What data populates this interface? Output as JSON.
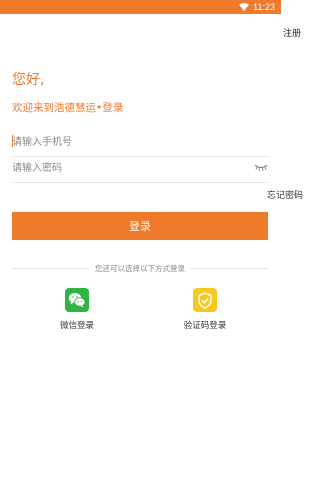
{
  "status_bar": {
    "time": "11:23"
  },
  "header": {
    "register_label": "注册"
  },
  "main": {
    "greeting": "您好,",
    "welcome": "欢迎来到浩德慧运•登录"
  },
  "form": {
    "phone_placeholder": "请输入手机号",
    "password_placeholder": "请输入密码",
    "forgot_label": "忘记密码",
    "login_label": "登录"
  },
  "alt_login": {
    "divider_text": "您还可以选择以下方式登录",
    "items": [
      {
        "label": "微信登录",
        "icon": "wechat-icon"
      },
      {
        "label": "验证码登录",
        "icon": "shield-check-icon"
      }
    ]
  },
  "colors": {
    "accent": "#f07a2b",
    "wechat": "#2fb545",
    "code": "#f7c820"
  }
}
